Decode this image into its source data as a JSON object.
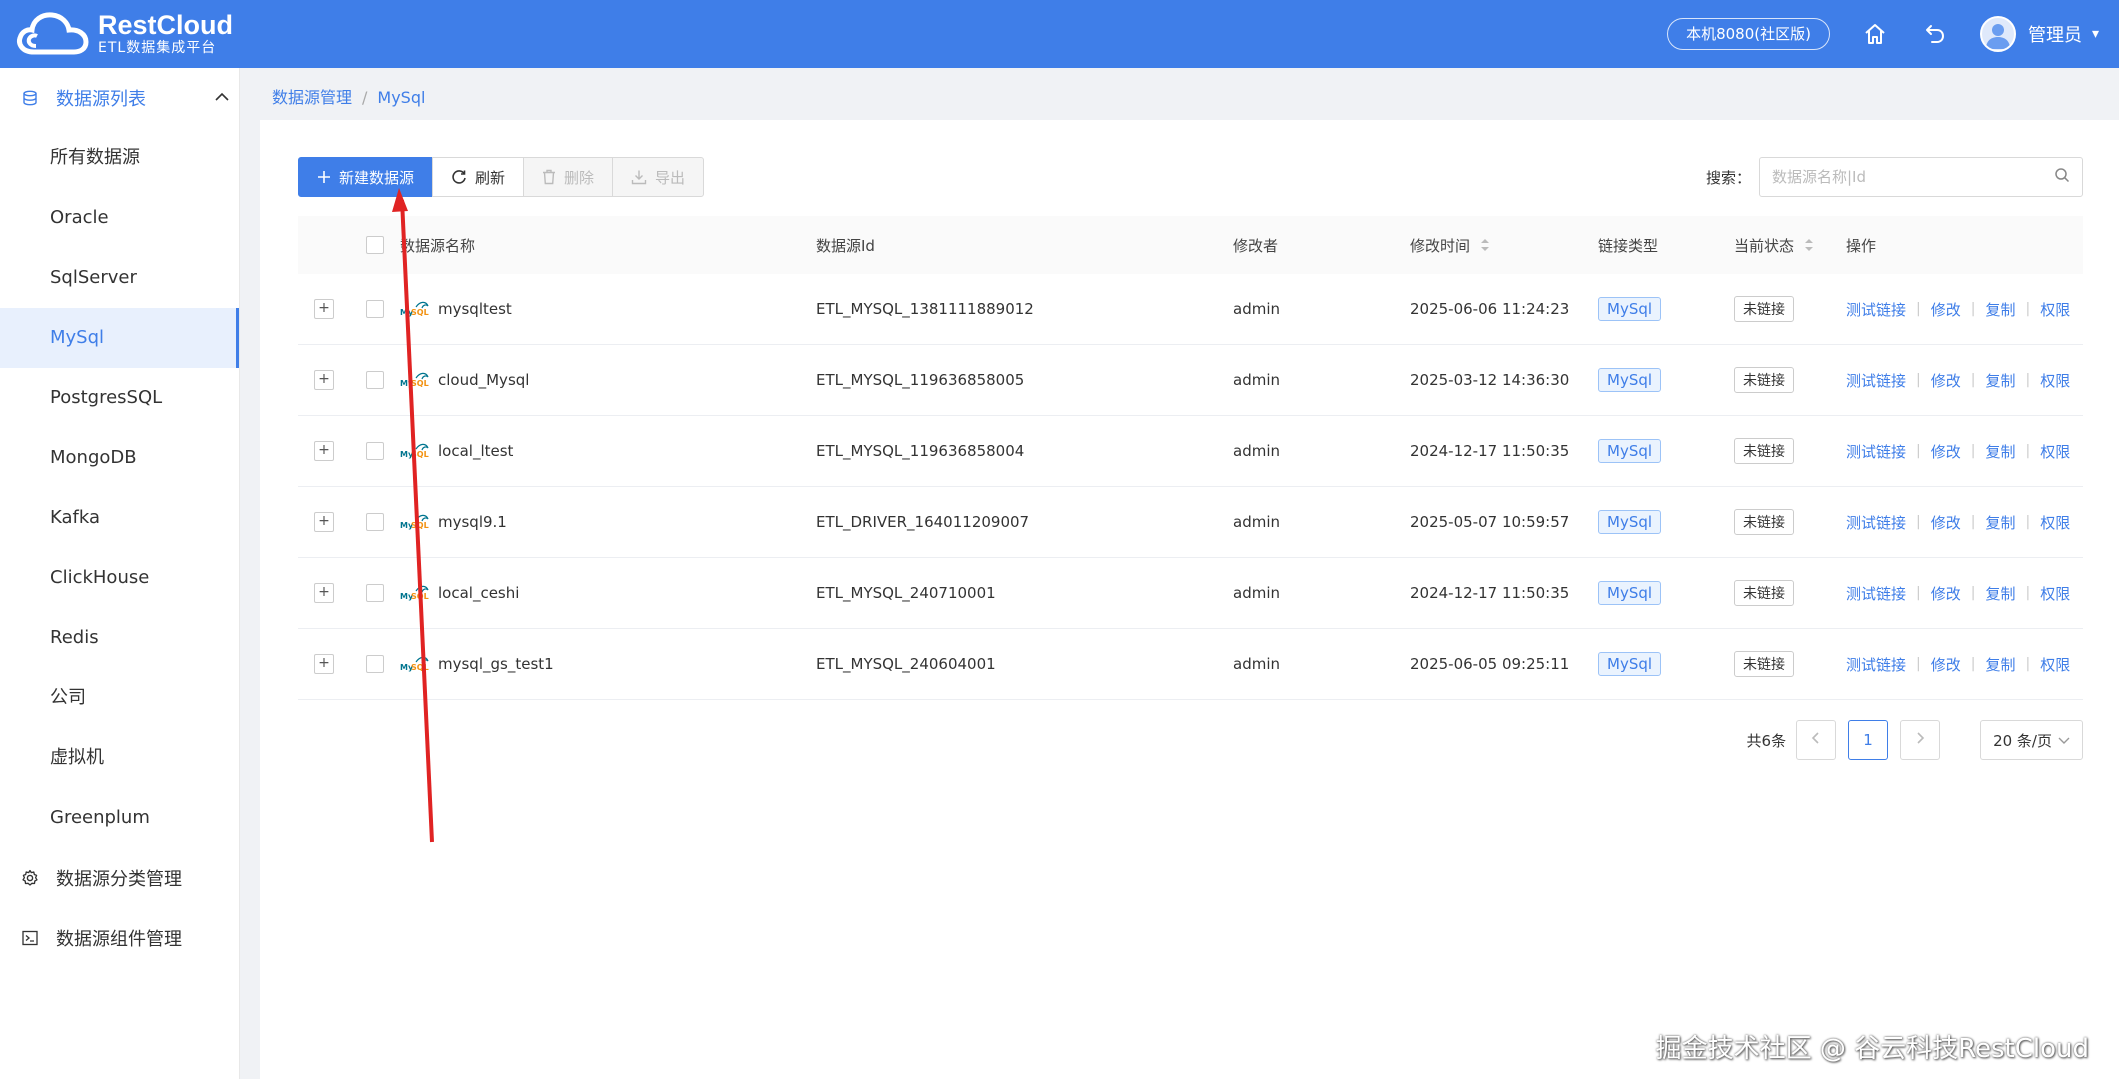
{
  "app": {
    "title": "RestCloud",
    "subtitle": "ETL数据集成平台",
    "env_label": "本机8080(社区版)",
    "user_name": "管理员"
  },
  "colors": {
    "brand": "#3f7ee8",
    "annotation_arrow": "#e02323"
  },
  "sidebar": {
    "group_label": "数据源列表",
    "items": [
      {
        "label": "所有数据源"
      },
      {
        "label": "Oracle"
      },
      {
        "label": "SqlServer"
      },
      {
        "label": "MySql"
      },
      {
        "label": "PostgresSQL"
      },
      {
        "label": "MongoDB"
      },
      {
        "label": "Kafka"
      },
      {
        "label": "ClickHouse"
      },
      {
        "label": "Redis"
      },
      {
        "label": "公司"
      },
      {
        "label": "虚拟机"
      },
      {
        "label": "Greenplum"
      }
    ],
    "category_mgmt": "数据源分类管理",
    "component_mgmt": "数据源组件管理"
  },
  "breadcrumb": {
    "root": "数据源管理",
    "sep": "/",
    "current": "MySql"
  },
  "toolbar": {
    "new_label": "新建数据源",
    "refresh_label": "刷新",
    "delete_label": "删除",
    "export_label": "导出"
  },
  "search": {
    "label": "搜索：",
    "placeholder": "数据源名称|Id"
  },
  "table": {
    "headers": {
      "name": "数据源名称",
      "id": "数据源Id",
      "modifier": "修改者",
      "time": "修改时间",
      "type": "链接类型",
      "state": "当前状态",
      "ops": "操作"
    },
    "ops": {
      "test": "测试链接",
      "edit": "修改",
      "copy": "复制",
      "perm": "权限",
      "sep": "|"
    },
    "rows": [
      {
        "name": "mysqltest",
        "id": "ETL_MYSQL_1381111889012",
        "modifier": "admin",
        "time": "2025-06-06 11:24:23",
        "type": "MySql",
        "state": "未链接"
      },
      {
        "name": "cloud_Mysql",
        "id": "ETL_MYSQL_119636858005",
        "modifier": "admin",
        "time": "2025-03-12 14:36:30",
        "type": "MySql",
        "state": "未链接"
      },
      {
        "name": "local_ltest",
        "id": "ETL_MYSQL_119636858004",
        "modifier": "admin",
        "time": "2024-12-17 11:50:35",
        "type": "MySql",
        "state": "未链接"
      },
      {
        "name": "mysql9.1",
        "id": "ETL_DRIVER_164011209007",
        "modifier": "admin",
        "time": "2025-05-07 10:59:57",
        "type": "MySql",
        "state": "未链接"
      },
      {
        "name": "local_ceshi",
        "id": "ETL_MYSQL_240710001",
        "modifier": "admin",
        "time": "2024-12-17 11:50:35",
        "type": "MySql",
        "state": "未链接"
      },
      {
        "name": "mysql_gs_test1",
        "id": "ETL_MYSQL_240604001",
        "modifier": "admin",
        "time": "2025-06-05 09:25:11",
        "type": "MySql",
        "state": "未链接"
      }
    ]
  },
  "pagination": {
    "total": "共6条",
    "current_page": "1",
    "page_size": "20 条/页"
  },
  "watermark": "掘金技术社区 @ 谷云科技RestCloud"
}
